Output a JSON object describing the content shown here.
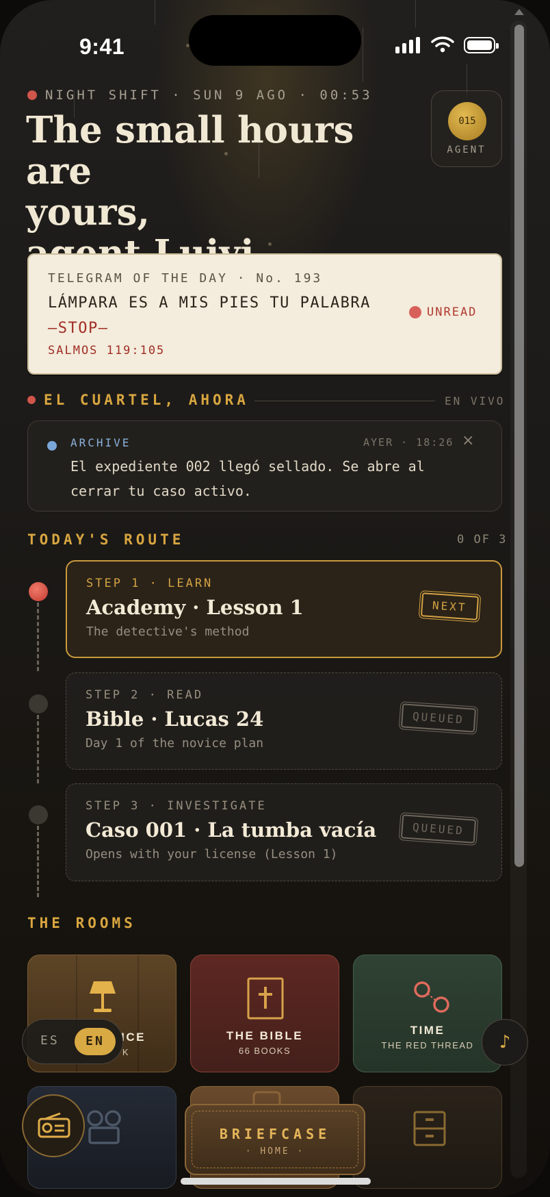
{
  "status_bar": {
    "time": "9:41"
  },
  "header": {
    "kicker": "NIGHT SHIFT · SUN 9 AGO · 00:53",
    "greeting_line1": "The small hours are",
    "greeting_line2": "yours,",
    "greeting_line3": "agent Luiyi",
    "agent_number": "015",
    "agent_label": "AGENT"
  },
  "telegram": {
    "label": "TELEGRAM OF THE DAY · No. 193",
    "message": "LÁMPARA ES A MIS PIES TU PALABRA",
    "stop": "—STOP—",
    "reference": "SALMOS 119:105",
    "status": "UNREAD"
  },
  "headquarters": {
    "title": "EL CUARTEL, AHORA",
    "live_label": "EN VIVO",
    "notification": {
      "tag": "ARCHIVE",
      "time": "AYER · 18:26",
      "message": "El expediente 002 llegó sellado. Se abre al cerrar tu caso activo.",
      "close_icon": "×"
    }
  },
  "route": {
    "title": "TODAY'S ROUTE",
    "count": "0 OF 3",
    "steps": [
      {
        "tag": "STEP 1 · LEARN",
        "title": "Academy · Lesson 1",
        "subtitle": "The detective's method",
        "stamp": "NEXT",
        "state": "active"
      },
      {
        "tag": "STEP 2 · READ",
        "title": "Bible · Lucas 24",
        "subtitle": "Day 1 of the novice plan",
        "stamp": "QUEUED",
        "state": "queued"
      },
      {
        "tag": "STEP 3 · INVESTIGATE",
        "title": "Caso 001 · La tumba vacía",
        "subtitle": "Opens with your license (Lesson 1)",
        "stamp": "QUEUED",
        "state": "queued"
      }
    ]
  },
  "rooms": {
    "title": "THE ROOMS",
    "items": [
      {
        "title": "ICE",
        "subtitle": "K",
        "icon": "lamp-icon"
      },
      {
        "title": "THE BIBLE",
        "subtitle": "66 BOOKS",
        "icon": "bible-cross-icon"
      },
      {
        "title": "TIME",
        "subtitle": "THE RED THREAD",
        "icon": "red-thread-icon"
      }
    ]
  },
  "language": {
    "es": "ES",
    "en": "EN",
    "selected": "EN"
  },
  "music_icon": "♪",
  "briefcase": {
    "title": "BRIEFCASE",
    "subtitle": "· HOME ·"
  },
  "colors": {
    "accent_gold": "#d9a944",
    "alert_red": "#d0554a",
    "paper": "#f4ecdc",
    "archive_blue": "#7aa7d8"
  }
}
